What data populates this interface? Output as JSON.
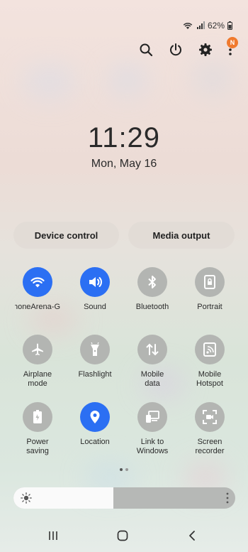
{
  "status": {
    "battery": "62%"
  },
  "top_icons": [
    "search-icon",
    "power-icon",
    "gear-icon",
    "more-vert-icon"
  ],
  "notification_badge": "N",
  "clock": {
    "time": "11:29",
    "date": "Mon, May 16"
  },
  "quick_buttons": {
    "device_control": "Device control",
    "media_output": "Media output"
  },
  "tiles": [
    {
      "label": "honeArena-G",
      "icon": "wifi-icon",
      "active": true
    },
    {
      "label": "Sound",
      "icon": "sound-icon",
      "active": true
    },
    {
      "label": "Bluetooth",
      "icon": "bluetooth-icon",
      "active": false
    },
    {
      "label": "Portrait",
      "icon": "portrait-lock-icon",
      "active": false
    },
    {
      "label": "Airplane\nmode",
      "icon": "airplane-icon",
      "active": false
    },
    {
      "label": "Flashlight",
      "icon": "flashlight-icon",
      "active": false
    },
    {
      "label": "Mobile\ndata",
      "icon": "mobile-data-icon",
      "active": false
    },
    {
      "label": "Mobile\nHotspot",
      "icon": "hotspot-icon",
      "active": false
    },
    {
      "label": "Power\nsaving",
      "icon": "power-saving-icon",
      "active": false
    },
    {
      "label": "Location",
      "icon": "location-icon",
      "active": true
    },
    {
      "label": "Link to\nWindows",
      "icon": "link-to-windows-icon",
      "active": false
    },
    {
      "label": "Screen\nrecorder",
      "icon": "screen-recorder-icon",
      "active": false
    }
  ],
  "brightness": {
    "level": 0.45
  },
  "colors": {
    "accent": "#2b6ff3",
    "tile_off": "#b3b5b2",
    "badge": "#f07a2e"
  }
}
